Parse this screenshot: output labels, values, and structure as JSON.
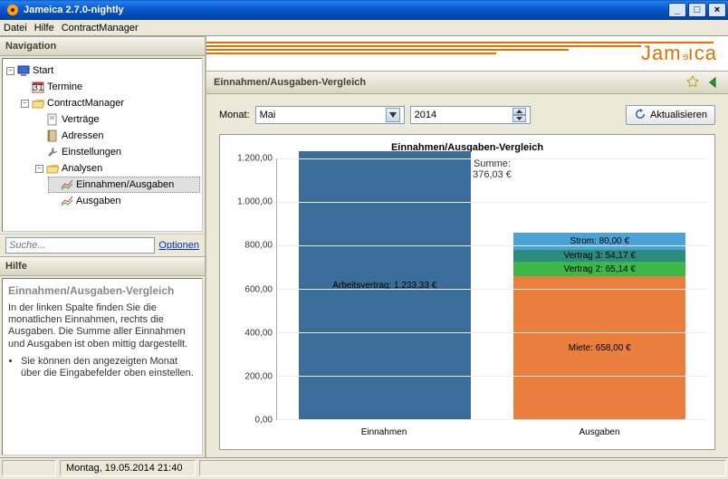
{
  "window": {
    "title": "Jameica 2.7.0-nightly"
  },
  "menubar": {
    "items": [
      "Datei",
      "Hilfe",
      "ContractManager"
    ]
  },
  "brand": "Jameica",
  "nav": {
    "title": "Navigation",
    "search_placeholder": "Suche...",
    "options_link": "Optionen",
    "tree": {
      "start": "Start",
      "termine": "Termine",
      "contractmanager": "ContractManager",
      "vertraege": "Verträge",
      "adressen": "Adressen",
      "einstellungen": "Einstellungen",
      "analysen": "Analysen",
      "einnahmen_ausgaben": "Einnahmen/Ausgaben",
      "ausgaben": "Ausgaben"
    }
  },
  "help": {
    "title": "Hilfe",
    "heading": "Einnahmen/Ausgaben-Vergleich",
    "para": "In der linken Spalte finden Sie die monatlichen Einnahmen, rechts die Ausgaben. Die Summe aller Einnahmen und Ausgaben ist oben mittig dargestellt.",
    "bullet1": "Sie können den angezeigten Monat über die Eingabefelder oben einstellen."
  },
  "content": {
    "heading": "Einnahmen/Ausgaben-Vergleich",
    "month_label": "Monat:",
    "month_value": "Mai",
    "year_value": "2014",
    "refresh_label": "Aktualisieren"
  },
  "chart_data": {
    "type": "bar",
    "title": "Einnahmen/Ausgaben-Vergleich",
    "categories": [
      "Einnahmen",
      "Ausgaben"
    ],
    "ylim": [
      0,
      1200
    ],
    "yticks": [
      "0,00",
      "200,00",
      "400,00",
      "600,00",
      "800,00",
      "1.000,00",
      "1.200,00"
    ],
    "summary": {
      "label": "Summe:",
      "value": "376,03 €"
    },
    "series": [
      {
        "category": "Einnahmen",
        "segments": [
          {
            "name": "Arbeitsvertrag",
            "label": "Arbeitsvertrag: 1.233,33 €",
            "value": 1233.33,
            "color": "#3a6d99"
          }
        ]
      },
      {
        "category": "Ausgaben",
        "segments": [
          {
            "name": "Miete",
            "label": "Miete: 658,00 €",
            "value": 658.0,
            "color": "#ea7e3d"
          },
          {
            "name": "Vertrag 2",
            "label": "Vertrag 2: 65,14 €",
            "value": 65.14,
            "color": "#3cb848"
          },
          {
            "name": "Vertrag 3",
            "label": "Vertrag 3: 54,17 €",
            "value": 54.17,
            "color": "#2d8a7e"
          },
          {
            "name": "Strom",
            "label": "Strom: 80,00 €",
            "value": 80.0,
            "color": "#4aa3d7"
          }
        ]
      }
    ]
  },
  "status": {
    "date": "Montag, 19.05.2014 21:40"
  }
}
